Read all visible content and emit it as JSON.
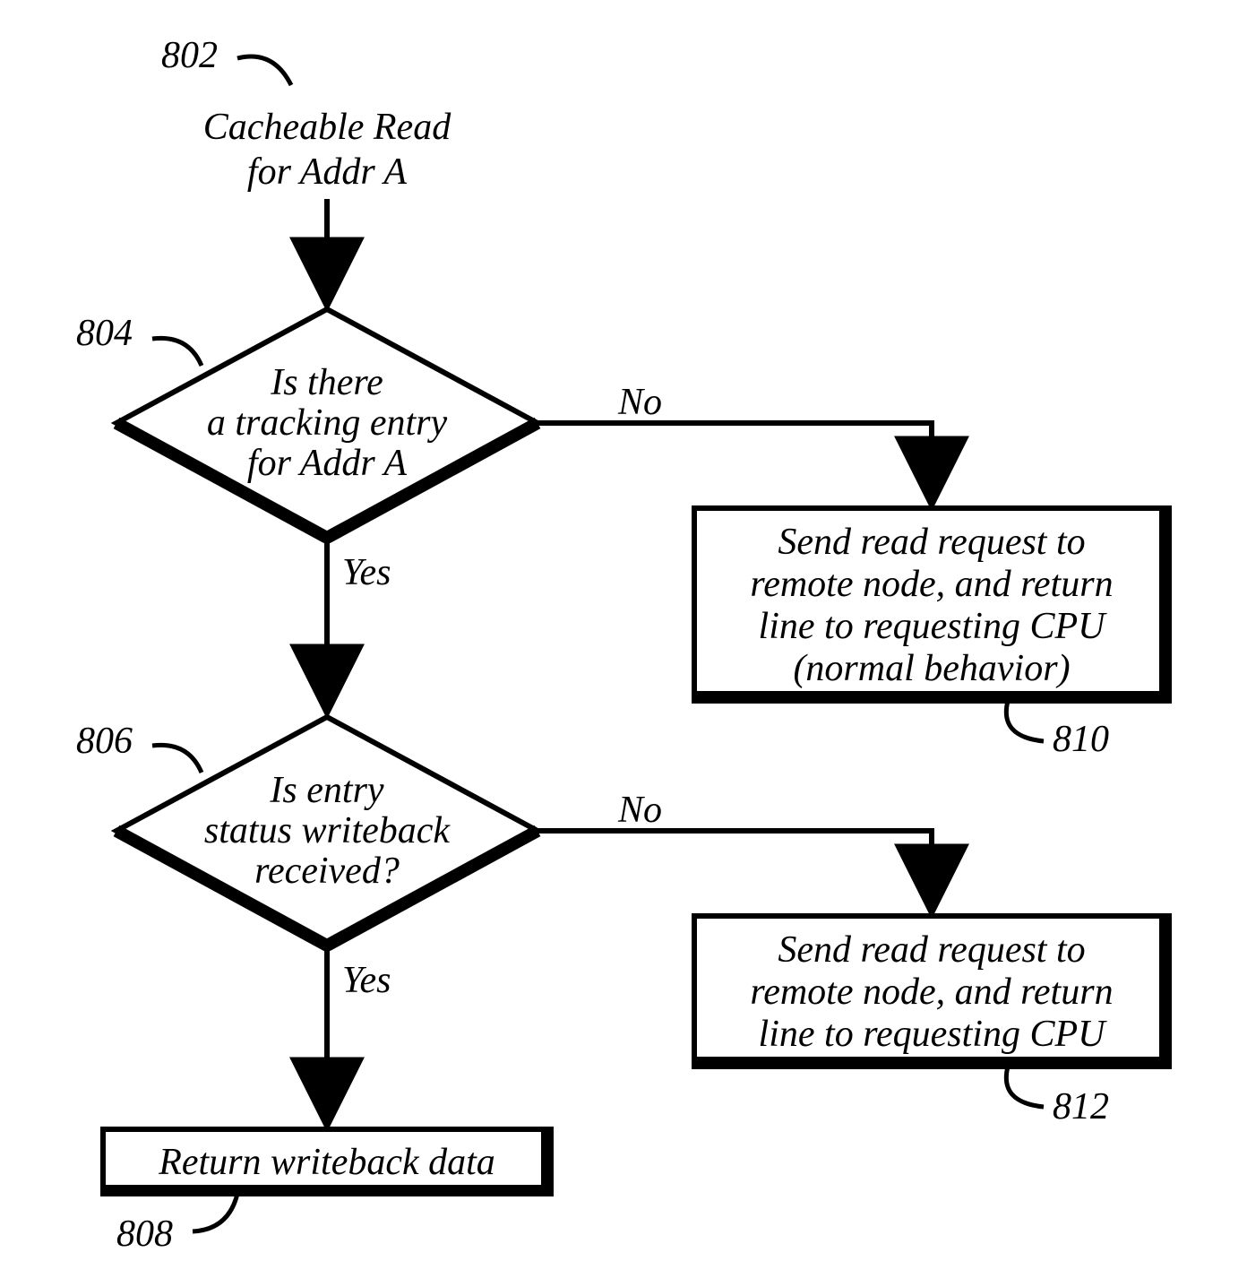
{
  "refs": {
    "r802": "802",
    "r804": "804",
    "r806": "806",
    "r808": "808",
    "r810": "810",
    "r812": "812"
  },
  "start": {
    "line1": "Cacheable Read",
    "line2": "for Addr A"
  },
  "d1": {
    "line1": "Is there",
    "line2": "a tracking entry",
    "line3": "for Addr A"
  },
  "d2": {
    "line1": "Is entry",
    "line2": "status writeback",
    "line3": "received?"
  },
  "box810": {
    "line1": "Send read request to",
    "line2": "remote node, and return",
    "line3": "line to requesting CPU",
    "line4": "(normal behavior)"
  },
  "box812": {
    "line1": "Send read request to",
    "line2": "remote node, and return",
    "line3": "line to requesting CPU"
  },
  "box808": {
    "line1": "Return writeback data"
  },
  "branches": {
    "yes1": "Yes",
    "no1": "No",
    "yes2": "Yes",
    "no2": "No"
  }
}
